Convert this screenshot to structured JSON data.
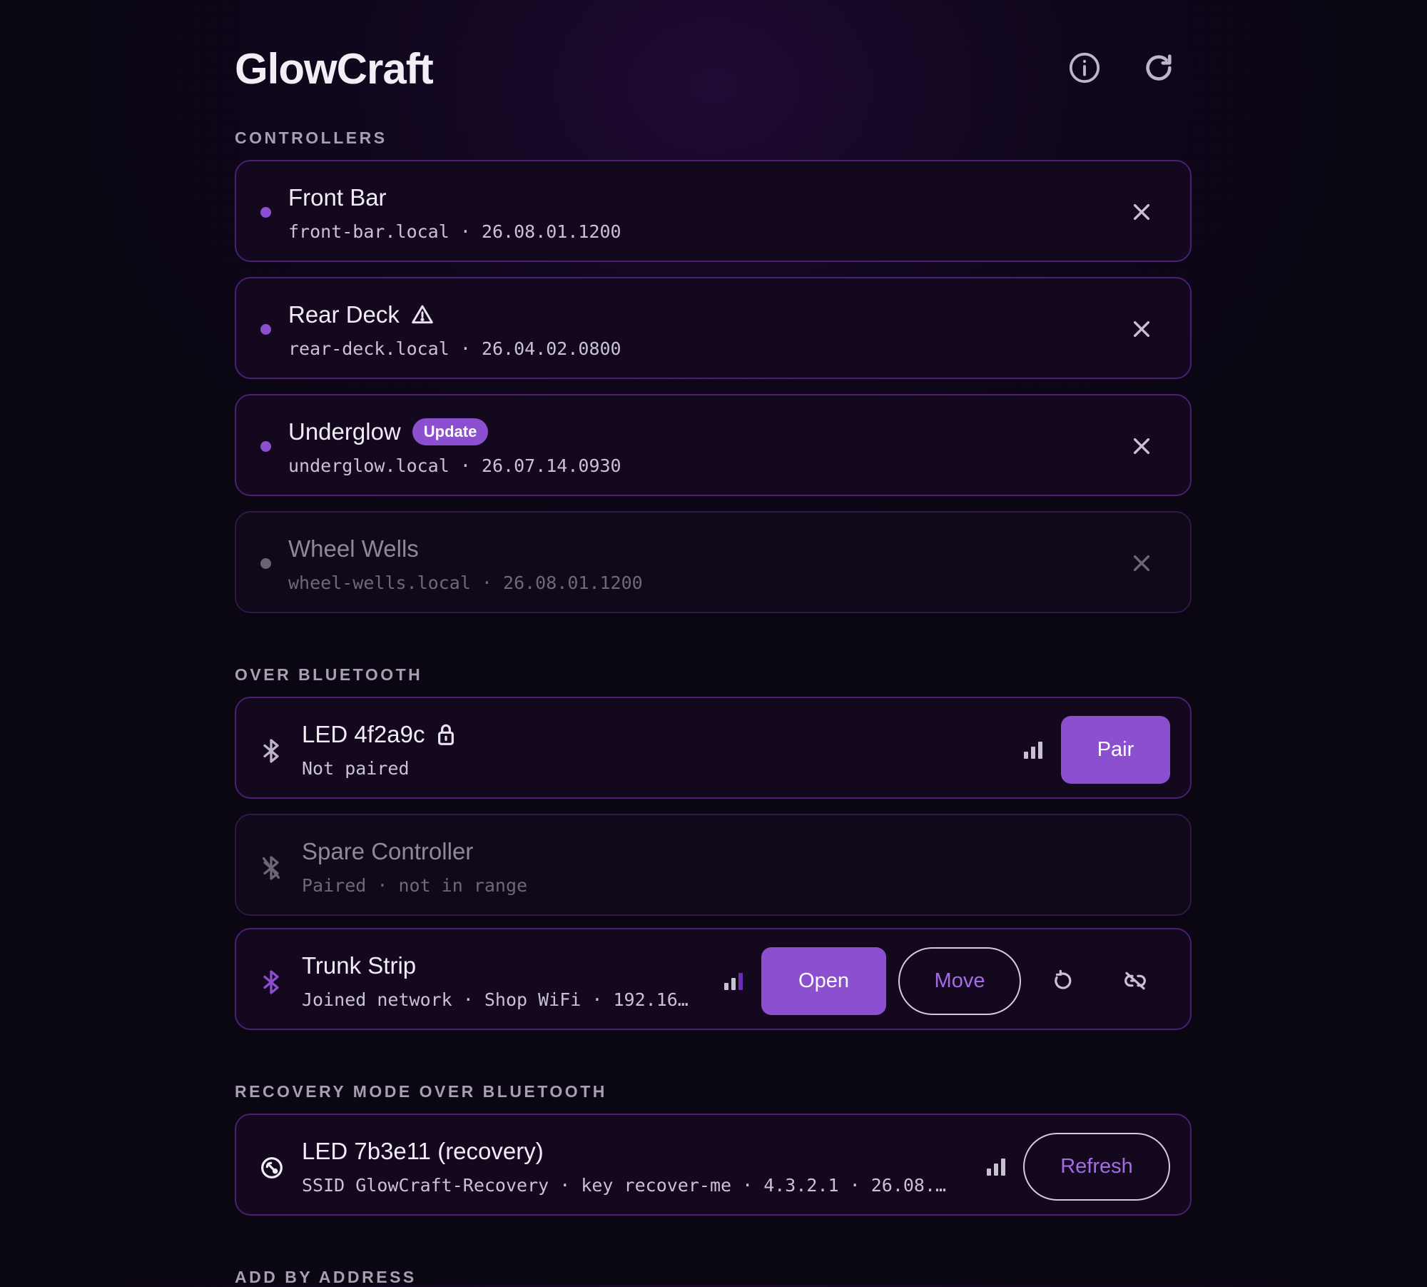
{
  "app": {
    "title": "GlowCraft"
  },
  "sections": {
    "controllers": "CONTROLLERS",
    "bluetooth": "OVER BLUETOOTH",
    "recovery": "RECOVERY MODE OVER BLUETOOTH",
    "add": "ADD BY ADDRESS"
  },
  "controllers": [
    {
      "name": "Front Bar",
      "host": "front-bar.local",
      "version": "26.08.01.1200",
      "status": "online"
    },
    {
      "name": "Rear Deck",
      "host": "rear-deck.local",
      "version": "26.04.02.0800",
      "status": "warning"
    },
    {
      "name": "Underglow",
      "host": "underglow.local",
      "version": "26.07.14.0930",
      "status": "update",
      "badge": "Update"
    },
    {
      "name": "Wheel Wells",
      "host": "wheel-wells.local",
      "version": "26.08.01.1200",
      "status": "offline"
    }
  ],
  "bluetooth": [
    {
      "name": "LED 4f2a9c",
      "sub": "Not paired",
      "action": "Pair",
      "signal_bars": 3
    },
    {
      "name": "Spare Controller",
      "sub": "Paired · not in range"
    },
    {
      "name": "Trunk Strip",
      "sub": "Joined network · Shop WiFi · 192.16…",
      "open": "Open",
      "move": "Move",
      "signal_bars": 2
    }
  ],
  "recovery": [
    {
      "name": "LED 7b3e11 (recovery)",
      "sub": "SSID GlowCraft-Recovery · key recover-me · 4.3.2.1 · 26.08.…",
      "action": "Refresh",
      "signal_bars": 3
    }
  ],
  "colors": {
    "accent": "#8b4fd0",
    "card_border": "#4a1f74",
    "background": "#0a0612"
  },
  "icons": [
    "info-icon",
    "refresh-icon",
    "close-icon",
    "warning-icon",
    "lock-icon",
    "bluetooth-icon",
    "bluetooth-off-icon",
    "signal-icon",
    "rotate-icon",
    "unlink-icon",
    "recovery-icon"
  ]
}
